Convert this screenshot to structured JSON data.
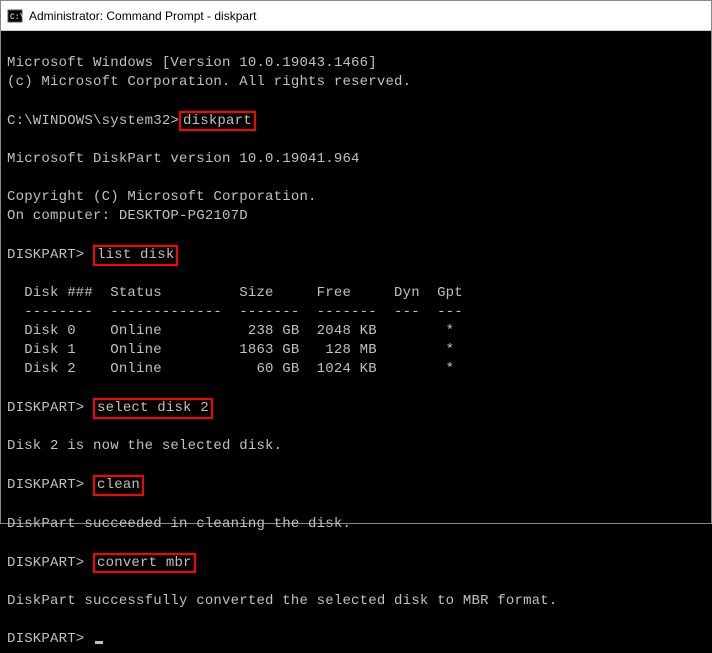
{
  "window": {
    "title": "Administrator: Command Prompt - diskpart"
  },
  "lines": {
    "winver": "Microsoft Windows [Version 10.0.19043.1466]",
    "copyright1": "(c) Microsoft Corporation. All rights reserved.",
    "prompt1_prefix": "C:\\WINDOWS\\system32>",
    "cmd_diskpart": "diskpart",
    "dp_version": "Microsoft DiskPart version 10.0.19041.964",
    "dp_copyright": "Copyright (C) Microsoft Corporation.",
    "dp_computer": "On computer: DESKTOP-PG2107D",
    "dp_prompt": "DISKPART>",
    "cmd_listdisk": "list disk",
    "tbl_header": "  Disk ###  Status         Size     Free     Dyn  Gpt",
    "tbl_divider": "  --------  -------------  -------  -------  ---  ---",
    "tbl_row0": "  Disk 0    Online          238 GB  2048 KB        *",
    "tbl_row1": "  Disk 1    Online         1863 GB   128 MB        *",
    "tbl_row2": "  Disk 2    Online           60 GB  1024 KB        *",
    "cmd_select": "select disk 2",
    "msg_selected": "Disk 2 is now the selected disk.",
    "cmd_clean": "clean",
    "msg_clean": "DiskPart succeeded in cleaning the disk.",
    "cmd_convert": "convert mbr",
    "msg_convert": "DiskPart successfully converted the selected disk to MBR format."
  },
  "chart_data": {
    "type": "table",
    "title": "list disk",
    "columns": [
      "Disk ###",
      "Status",
      "Size",
      "Free",
      "Dyn",
      "Gpt"
    ],
    "rows": [
      {
        "disk": "Disk 0",
        "status": "Online",
        "size": "238 GB",
        "free": "2048 KB",
        "dyn": "",
        "gpt": "*"
      },
      {
        "disk": "Disk 1",
        "status": "Online",
        "size": "1863 GB",
        "free": "128 MB",
        "dyn": "",
        "gpt": "*"
      },
      {
        "disk": "Disk 2",
        "status": "Online",
        "size": "60 GB",
        "free": "1024 KB",
        "dyn": "",
        "gpt": "*"
      }
    ]
  }
}
